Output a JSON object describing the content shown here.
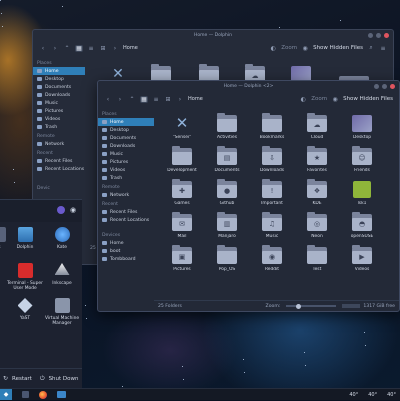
{
  "back_window": {
    "title": "Home — Dolphin",
    "breadcrumb": "Home",
    "actions": [
      "Zoom",
      "Show Hidden Files"
    ],
    "places_heading": "Places",
    "places": [
      "Home",
      "Desktop",
      "Documents",
      "Downloads",
      "Music",
      "Pictures",
      "Videos",
      "Trash"
    ],
    "remote_heading": "Remote",
    "remote": [
      "Network"
    ],
    "recent_heading": "Recent",
    "recent": [
      "Recent Files",
      "Recent Locations"
    ],
    "status_fragment": "25 Fo",
    "devices_fragment": "Devic"
  },
  "front_window": {
    "title": "Home — Dolphin <2>",
    "breadcrumb": "Home",
    "actions": {
      "zoom": "Zoom",
      "hidden": "Show Hidden Files"
    },
    "places_heading": "Places",
    "places": [
      "Home",
      "Desktop",
      "Documents",
      "Downloads",
      "Music",
      "Pictures",
      "Videos",
      "Trash"
    ],
    "remote_heading": "Remote",
    "remote": [
      "Network"
    ],
    "recent_heading": "Recent",
    "recent": [
      "Recent Files",
      "Recent Locations"
    ],
    "devices_heading": "Devices",
    "devices": [
      "Home",
      "boot",
      "Tombboard"
    ],
    "items": [
      {
        "label": "\"Sensei\"",
        "icon": "ribbon-icon"
      },
      {
        "label": "Activities",
        "icon": "folder-icon"
      },
      {
        "label": "Bookmarks",
        "icon": "folder-icon"
      },
      {
        "label": "Cloud",
        "icon": "cloud-folder-icon"
      },
      {
        "label": "Desktop",
        "icon": "desktop-folder-icon"
      },
      {
        "label": "Development",
        "icon": "folder-icon"
      },
      {
        "label": "Documents",
        "icon": "documents-folder-icon"
      },
      {
        "label": "Downloads",
        "icon": "downloads-folder-icon"
      },
      {
        "label": "Favorites",
        "icon": "star-folder-icon"
      },
      {
        "label": "Friends",
        "icon": "people-folder-icon"
      },
      {
        "label": "Games",
        "icon": "games-folder-icon"
      },
      {
        "label": "Github",
        "icon": "github-folder-icon"
      },
      {
        "label": "Important",
        "icon": "important-folder-icon"
      },
      {
        "label": "KDE",
        "icon": "kde-folder-icon"
      },
      {
        "label": "lsk1",
        "icon": "green-app-icon"
      },
      {
        "label": "Mail",
        "icon": "mail-folder-icon"
      },
      {
        "label": "Manjaro",
        "icon": "manjaro-folder-icon"
      },
      {
        "label": "Music",
        "icon": "music-folder-icon"
      },
      {
        "label": "Neon",
        "icon": "neon-folder-icon"
      },
      {
        "label": "openSUSE",
        "icon": "opensuse-folder-icon"
      },
      {
        "label": "Pictures",
        "icon": "pictures-folder-icon"
      },
      {
        "label": "Pop_OS",
        "icon": "folder-icon"
      },
      {
        "label": "Reddit",
        "icon": "reddit-folder-icon"
      },
      {
        "label": "Test",
        "icon": "folder-icon"
      },
      {
        "label": "Videos",
        "icon": "videos-folder-icon"
      }
    ],
    "status_count": "25 Folders",
    "status_zoom": "Zoom:",
    "status_free": "1317 GiB free"
  },
  "launcher": {
    "apps": [
      {
        "label": "gs",
        "icon": "gear-icon"
      },
      {
        "label": "Dolphin",
        "icon": "dolphin-icon"
      },
      {
        "label": "Kate",
        "icon": "kate-icon"
      },
      {
        "label": "Terminal - Super User Mode",
        "icon": "terminal-icon"
      },
      {
        "label": "Inkscape",
        "icon": "inkscape-icon"
      },
      {
        "label": "YaST",
        "icon": "yast-icon"
      },
      {
        "label": "Virtual Machine Manager",
        "icon": "vm-manager-icon"
      }
    ],
    "restart_label": "Restart",
    "shutdown_label": "Shut Down"
  },
  "tray": {
    "temps": [
      "40°",
      "40°",
      "40°"
    ]
  },
  "colors": {
    "accent": "#2f7fb8",
    "window_bg": "#242a38",
    "panel_bg": "#1d2230"
  }
}
